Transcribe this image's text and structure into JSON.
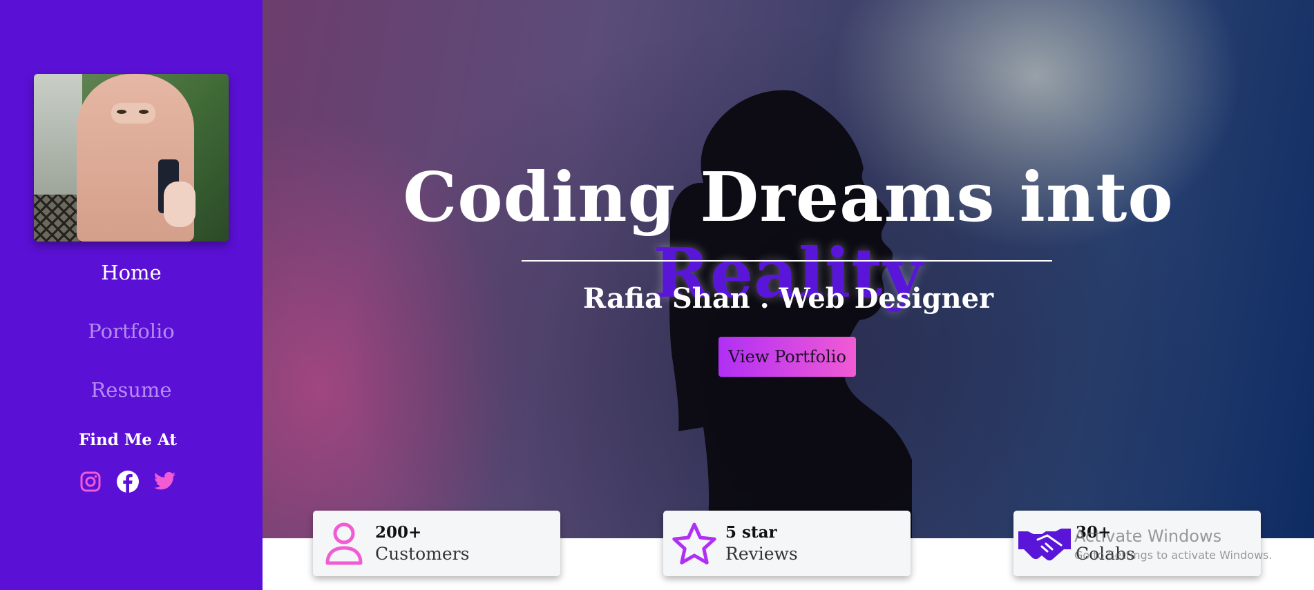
{
  "sidebar": {
    "nav": [
      "Home",
      "Portfolio",
      "Resume"
    ],
    "find_me_title": "Find Me At",
    "socials": [
      "instagram-icon",
      "facebook-icon",
      "twitter-icon"
    ]
  },
  "hero": {
    "title_main": "Coding Dreams into ",
    "title_accent": "Reality",
    "subtitle": "Rafia Shan . Web Designer",
    "cta_label": "View Portfolio"
  },
  "stats": [
    {
      "icon": "user-icon",
      "number": "200+",
      "label": "Customers"
    },
    {
      "icon": "star-icon",
      "number": "5 star",
      "label": "Reviews"
    },
    {
      "icon": "handshake-icon",
      "number": "30+",
      "label": "Colabs"
    }
  ],
  "watermark": {
    "line1": "Activate Windows",
    "line2": "Go to Settings to activate Windows."
  },
  "colors": {
    "sidebar": "#5b10d6",
    "accent": "#5a16d8",
    "pink": "#f15bd4",
    "cta_start": "#b02ff5"
  }
}
